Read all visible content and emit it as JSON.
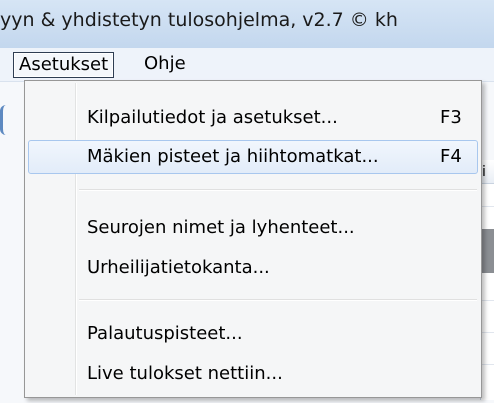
{
  "window": {
    "title": "yyn & yhdistetyn tulosohjelma, v2.7 © kh"
  },
  "menubar": {
    "items": [
      {
        "label": "Asetukset"
      },
      {
        "label": "Ohje"
      }
    ]
  },
  "background": {
    "grid_header": "i"
  },
  "dropdown": {
    "items": [
      {
        "label": "Kilpailutiedot ja asetukset...",
        "shortcut": "F3"
      },
      {
        "label": "Mäkien pisteet ja hiihtomatkat...",
        "shortcut": "F4"
      },
      {
        "label": "Seurojen nimet ja lyhenteet...",
        "shortcut": ""
      },
      {
        "label": "Urheilijatietokanta...",
        "shortcut": ""
      },
      {
        "label": "Palautuspisteet...",
        "shortcut": ""
      },
      {
        "label": "Live tulokset nettiin...",
        "shortcut": ""
      }
    ]
  }
}
